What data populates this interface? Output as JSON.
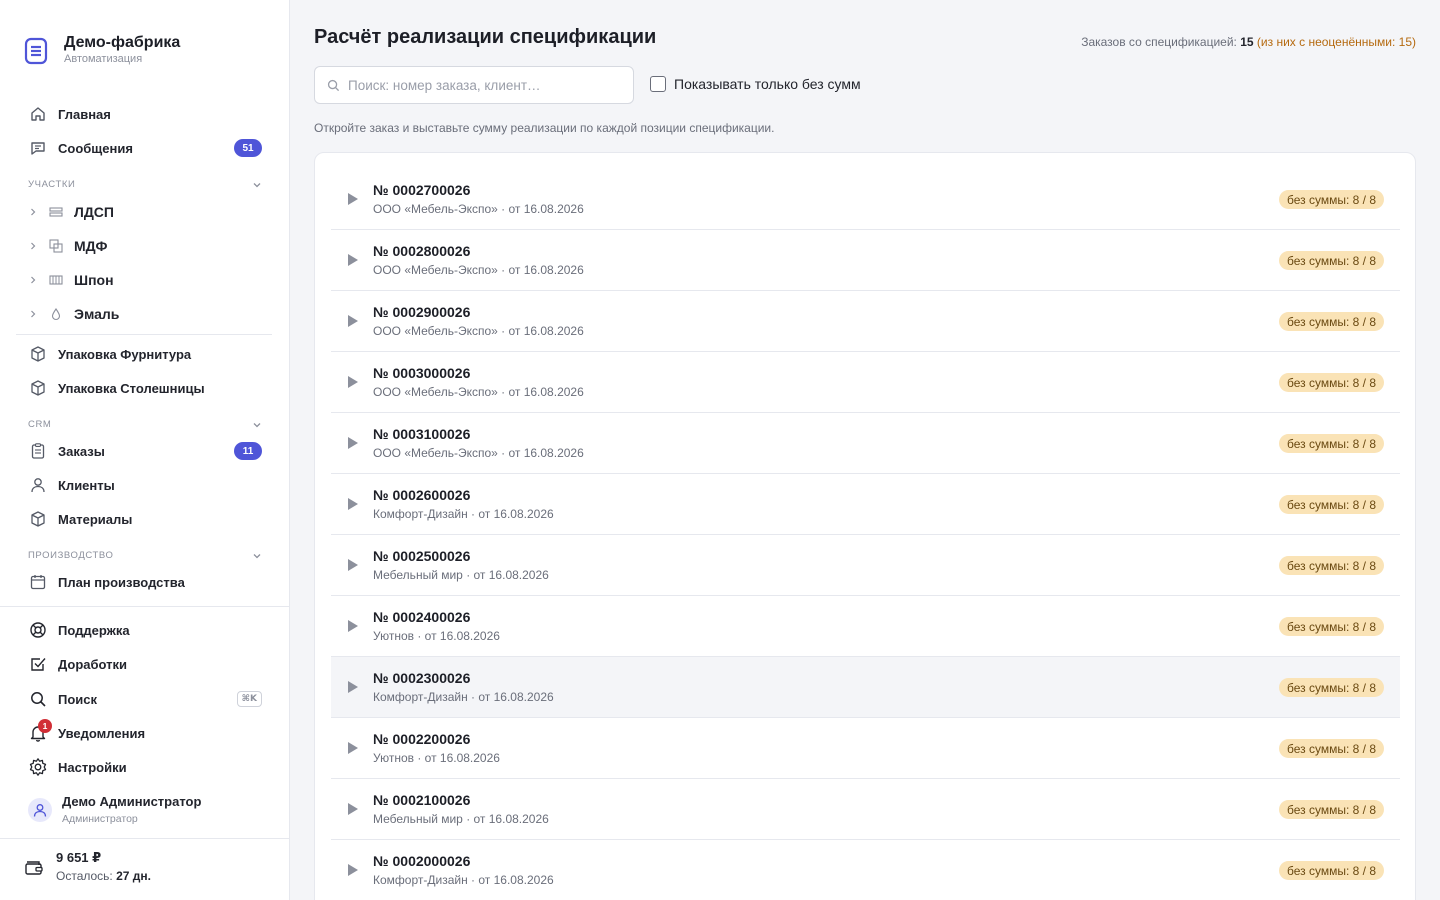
{
  "brand": {
    "name": "Демо-фабрика",
    "subtitle": "Автоматизация"
  },
  "nav": {
    "home": "Главная",
    "messages": {
      "label": "Сообщения",
      "badge": "51"
    },
    "sections": {
      "plots": "УЧАСТКИ",
      "crm": "CRM",
      "production": "ПРОИЗВОДСТВО"
    },
    "plots": [
      "ЛДСП",
      "МДФ",
      "Шпон",
      "Эмаль"
    ],
    "packaging_hardware": "Упаковка Фурнитура",
    "packaging_tops": "Упаковка Столешницы",
    "orders": {
      "label": "Заказы",
      "badge": "11"
    },
    "clients": "Клиенты",
    "materials": "Материалы",
    "production_plan": "План производства"
  },
  "bottom": {
    "support": "Поддержка",
    "improvements": "Доработки",
    "search": {
      "label": "Поиск",
      "shortcut": "⌘K"
    },
    "notifications": {
      "label": "Уведомления",
      "count": "1"
    },
    "settings": "Настройки",
    "user": {
      "name": "Демо Администратор",
      "role": "Администратор"
    },
    "wallet": {
      "sum": "9 651 ₽",
      "left_label": "Осталось:",
      "left_value": "27 дн."
    }
  },
  "main": {
    "title": "Расчёт реализации спецификации",
    "stat": {
      "label": "Заказов со спецификацией:",
      "count": "15",
      "note": "(из них с неоценёнными: 15)"
    },
    "search_placeholder": "Поиск: номер заказа, клиент…",
    "filter_label": "Показывать только без сумм",
    "hint": "Откройте заказ и выставьте сумму реализации по каждой позиции спецификации.",
    "orders": [
      {
        "number": "№ 0002700026",
        "meta": "ООО «Мебель-Экспо» · от 16.08.2026",
        "status": "без суммы: 8 / 8"
      },
      {
        "number": "№ 0002800026",
        "meta": "ООО «Мебель-Экспо» · от 16.08.2026",
        "status": "без суммы: 8 / 8"
      },
      {
        "number": "№ 0002900026",
        "meta": "ООО «Мебель-Экспо» · от 16.08.2026",
        "status": "без суммы: 8 / 8"
      },
      {
        "number": "№ 0003000026",
        "meta": "ООО «Мебель-Экспо» · от 16.08.2026",
        "status": "без суммы: 8 / 8"
      },
      {
        "number": "№ 0003100026",
        "meta": "ООО «Мебель-Экспо» · от 16.08.2026",
        "status": "без суммы: 8 / 8"
      },
      {
        "number": "№ 0002600026",
        "meta": "Комфорт-Дизайн · от 16.08.2026",
        "status": "без суммы: 8 / 8"
      },
      {
        "number": "№ 0002500026",
        "meta": "Мебельный мир · от 16.08.2026",
        "status": "без суммы: 8 / 8"
      },
      {
        "number": "№ 0002400026",
        "meta": "Уютнов · от 16.08.2026",
        "status": "без суммы: 8 / 8"
      },
      {
        "number": "№ 0002300026",
        "meta": "Комфорт-Дизайн · от 16.08.2026",
        "status": "без суммы: 8 / 8"
      },
      {
        "number": "№ 0002200026",
        "meta": "Уютнов · от 16.08.2026",
        "status": "без суммы: 8 / 8"
      },
      {
        "number": "№ 0002100026",
        "meta": "Мебельный мир · от 16.08.2026",
        "status": "без суммы: 8 / 8"
      },
      {
        "number": "№ 0002000026",
        "meta": "Комфорт-Дизайн · от 16.08.2026",
        "status": "без суммы: 8 / 8"
      }
    ]
  },
  "colors": {
    "accent": "#4f55d8",
    "warning_pill": "#fae3b6",
    "notification": "#d12e36"
  }
}
